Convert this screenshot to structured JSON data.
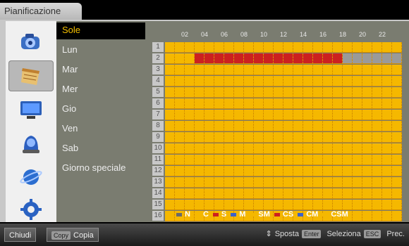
{
  "window": {
    "tab_title": "Pianificazione"
  },
  "icons": [
    {
      "name": "camera-icon"
    },
    {
      "name": "calendar-icon"
    },
    {
      "name": "monitor-icon"
    },
    {
      "name": "alarm-icon"
    },
    {
      "name": "network-icon"
    },
    {
      "name": "gear-icon"
    }
  ],
  "days": [
    "Sole",
    "Lun",
    "Mar",
    "Mer",
    "Gio",
    "Ven",
    "Sab",
    "Giorno speciale"
  ],
  "selected_day": "Sole",
  "schedule": {
    "hour_labels": [
      "02",
      "04",
      "06",
      "08",
      "10",
      "12",
      "14",
      "16",
      "18",
      "20",
      "22"
    ],
    "row_labels": [
      "1",
      "2",
      "3",
      "4",
      "5",
      "6",
      "7",
      "8",
      "9",
      "10",
      "11",
      "12",
      "13",
      "14",
      "15",
      "16"
    ],
    "rows": [
      "CCCCCCCCCCCCCCCCCCCCCCCC",
      "CCCSSSSSSSSSSSSSSSCCCCCC",
      "CCCCCCCCCCCCCCCCCCCCCCCC",
      "CCCCCCCCCCCCCCCCCCCCCCCC",
      "CCCCCCCCCCCCCCCCCCCCCCCC",
      "CCCCCCCCCCCCCCCCCCCCCCCC",
      "CCCCCCCCCCCCCCCCCCCCCCCC",
      "CCCCCCCCCCCCCCCCCCCCCCCC",
      "CCCCCCCCCCCCCCCCCCCCCCCC",
      "CCCCCCCCCCCCCCCCCCCCCCCC",
      "CCCCCCCCCCCCCCCCCCCCCCCC",
      "CCCCCCCCCCCCCCCCCCCCCCCC",
      "CCCCCCCCCCCCCCCCCCCCCCCC",
      "CCCCCCCCCCCCCCCCCCCCCCCC",
      "CCCCCCCCCCCCCCCCCCCCCCCC",
      "CCCCCCCCCCCCCCCCCCCCCCCC"
    ],
    "row2_overlay": {
      "from_col": 18,
      "to_col": 23,
      "code": "G"
    },
    "colors": {
      "C": "#f5b800",
      "S": "#cc2020",
      "G": "#9a9a9a",
      "N": "#6a6a6a",
      "M": "#3c62c8",
      "SM": "#f5b800",
      "CS": "#cc2020",
      "CM": "#3c62c8",
      "CSM": "#f5b800"
    }
  },
  "legend": [
    {
      "label": "N",
      "color": "#6a6a6a"
    },
    {
      "label": "C",
      "color": "#f5b800"
    },
    {
      "label": "S",
      "color": "#cc2020"
    },
    {
      "label": "M",
      "color": "#3c62c8"
    },
    {
      "label": "SM",
      "color": "#f5b800"
    },
    {
      "label": "CS",
      "color": "#cc2020"
    },
    {
      "label": "CM",
      "color": "#3c62c8"
    },
    {
      "label": "CSM",
      "color": "#f5b800"
    }
  ],
  "bottom": {
    "close_label": "Chiudi",
    "copy_key": "Copy",
    "copy_label": "Copia",
    "move_symbol": "⇕",
    "move_label": "Sposta",
    "enter_key": "Enter",
    "select_label": "Seleziona",
    "esc_key": "ESC",
    "prev_label": "Prec."
  }
}
